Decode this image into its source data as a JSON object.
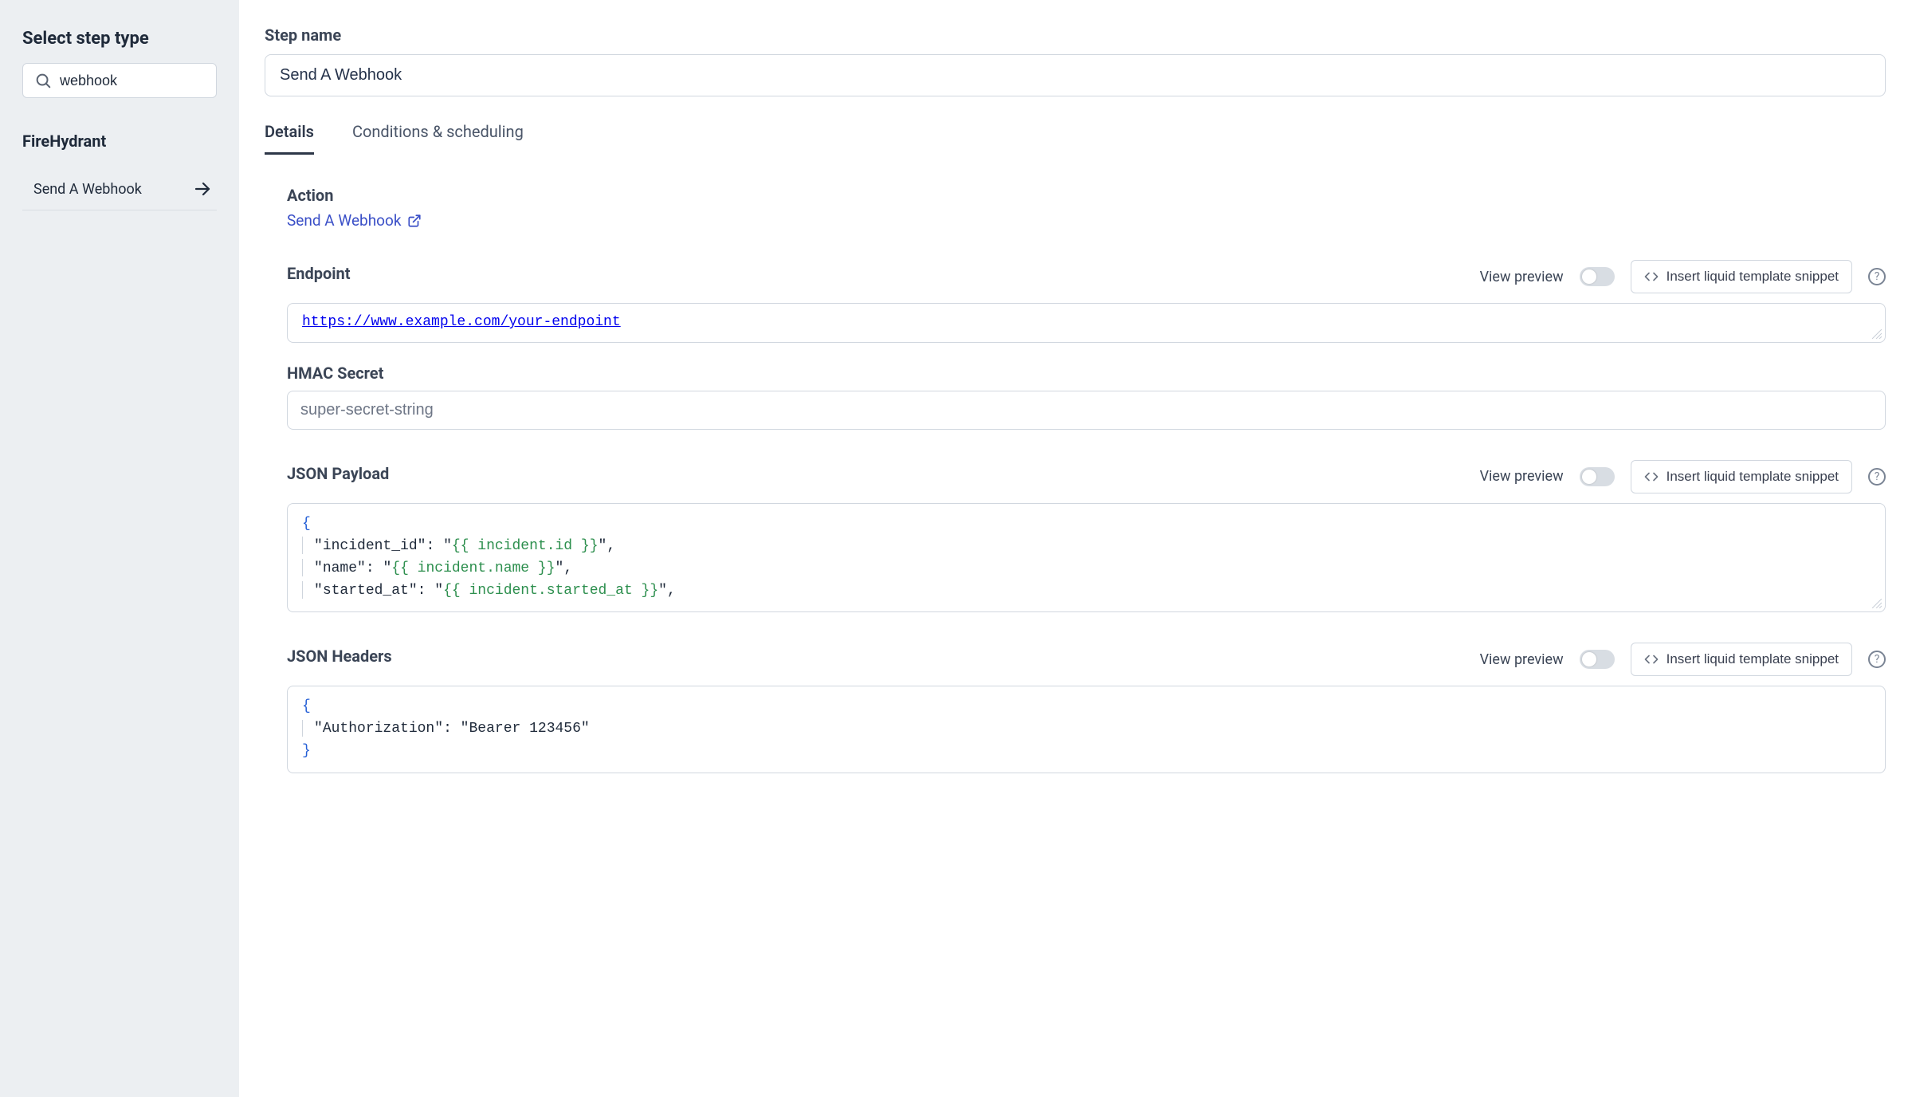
{
  "sidebar": {
    "title": "Select step type",
    "search_value": "webhook",
    "group_title": "FireHydrant",
    "items": [
      {
        "label": "Send A Webhook"
      }
    ]
  },
  "main": {
    "step_name_label": "Step name",
    "step_name_value": "Send A Webhook",
    "tabs": {
      "details": "Details",
      "conditions": "Conditions & scheduling"
    },
    "action": {
      "heading": "Action",
      "link_label": "Send A Webhook"
    },
    "endpoint": {
      "label": "Endpoint",
      "value": "https://www.example.com/your-endpoint",
      "view_preview_label": "View preview",
      "insert_snippet_label": "Insert liquid template snippet"
    },
    "hmac": {
      "label": "HMAC Secret",
      "placeholder": "super-secret-string"
    },
    "json_payload": {
      "label": "JSON Payload",
      "view_preview_label": "View preview",
      "insert_snippet_label": "Insert liquid template snippet",
      "key_incident_id": "incident_id",
      "val_incident_id": "{{ incident.id }}",
      "key_name": "name",
      "val_name": "{{ incident.name }}",
      "key_started_at": "started_at",
      "val_started_at": "{{ incident.started_at }}"
    },
    "json_headers": {
      "label": "JSON Headers",
      "view_preview_label": "View preview",
      "insert_snippet_label": "Insert liquid template snippet",
      "key_auth": "Authorization",
      "val_auth": "Bearer 123456"
    }
  }
}
